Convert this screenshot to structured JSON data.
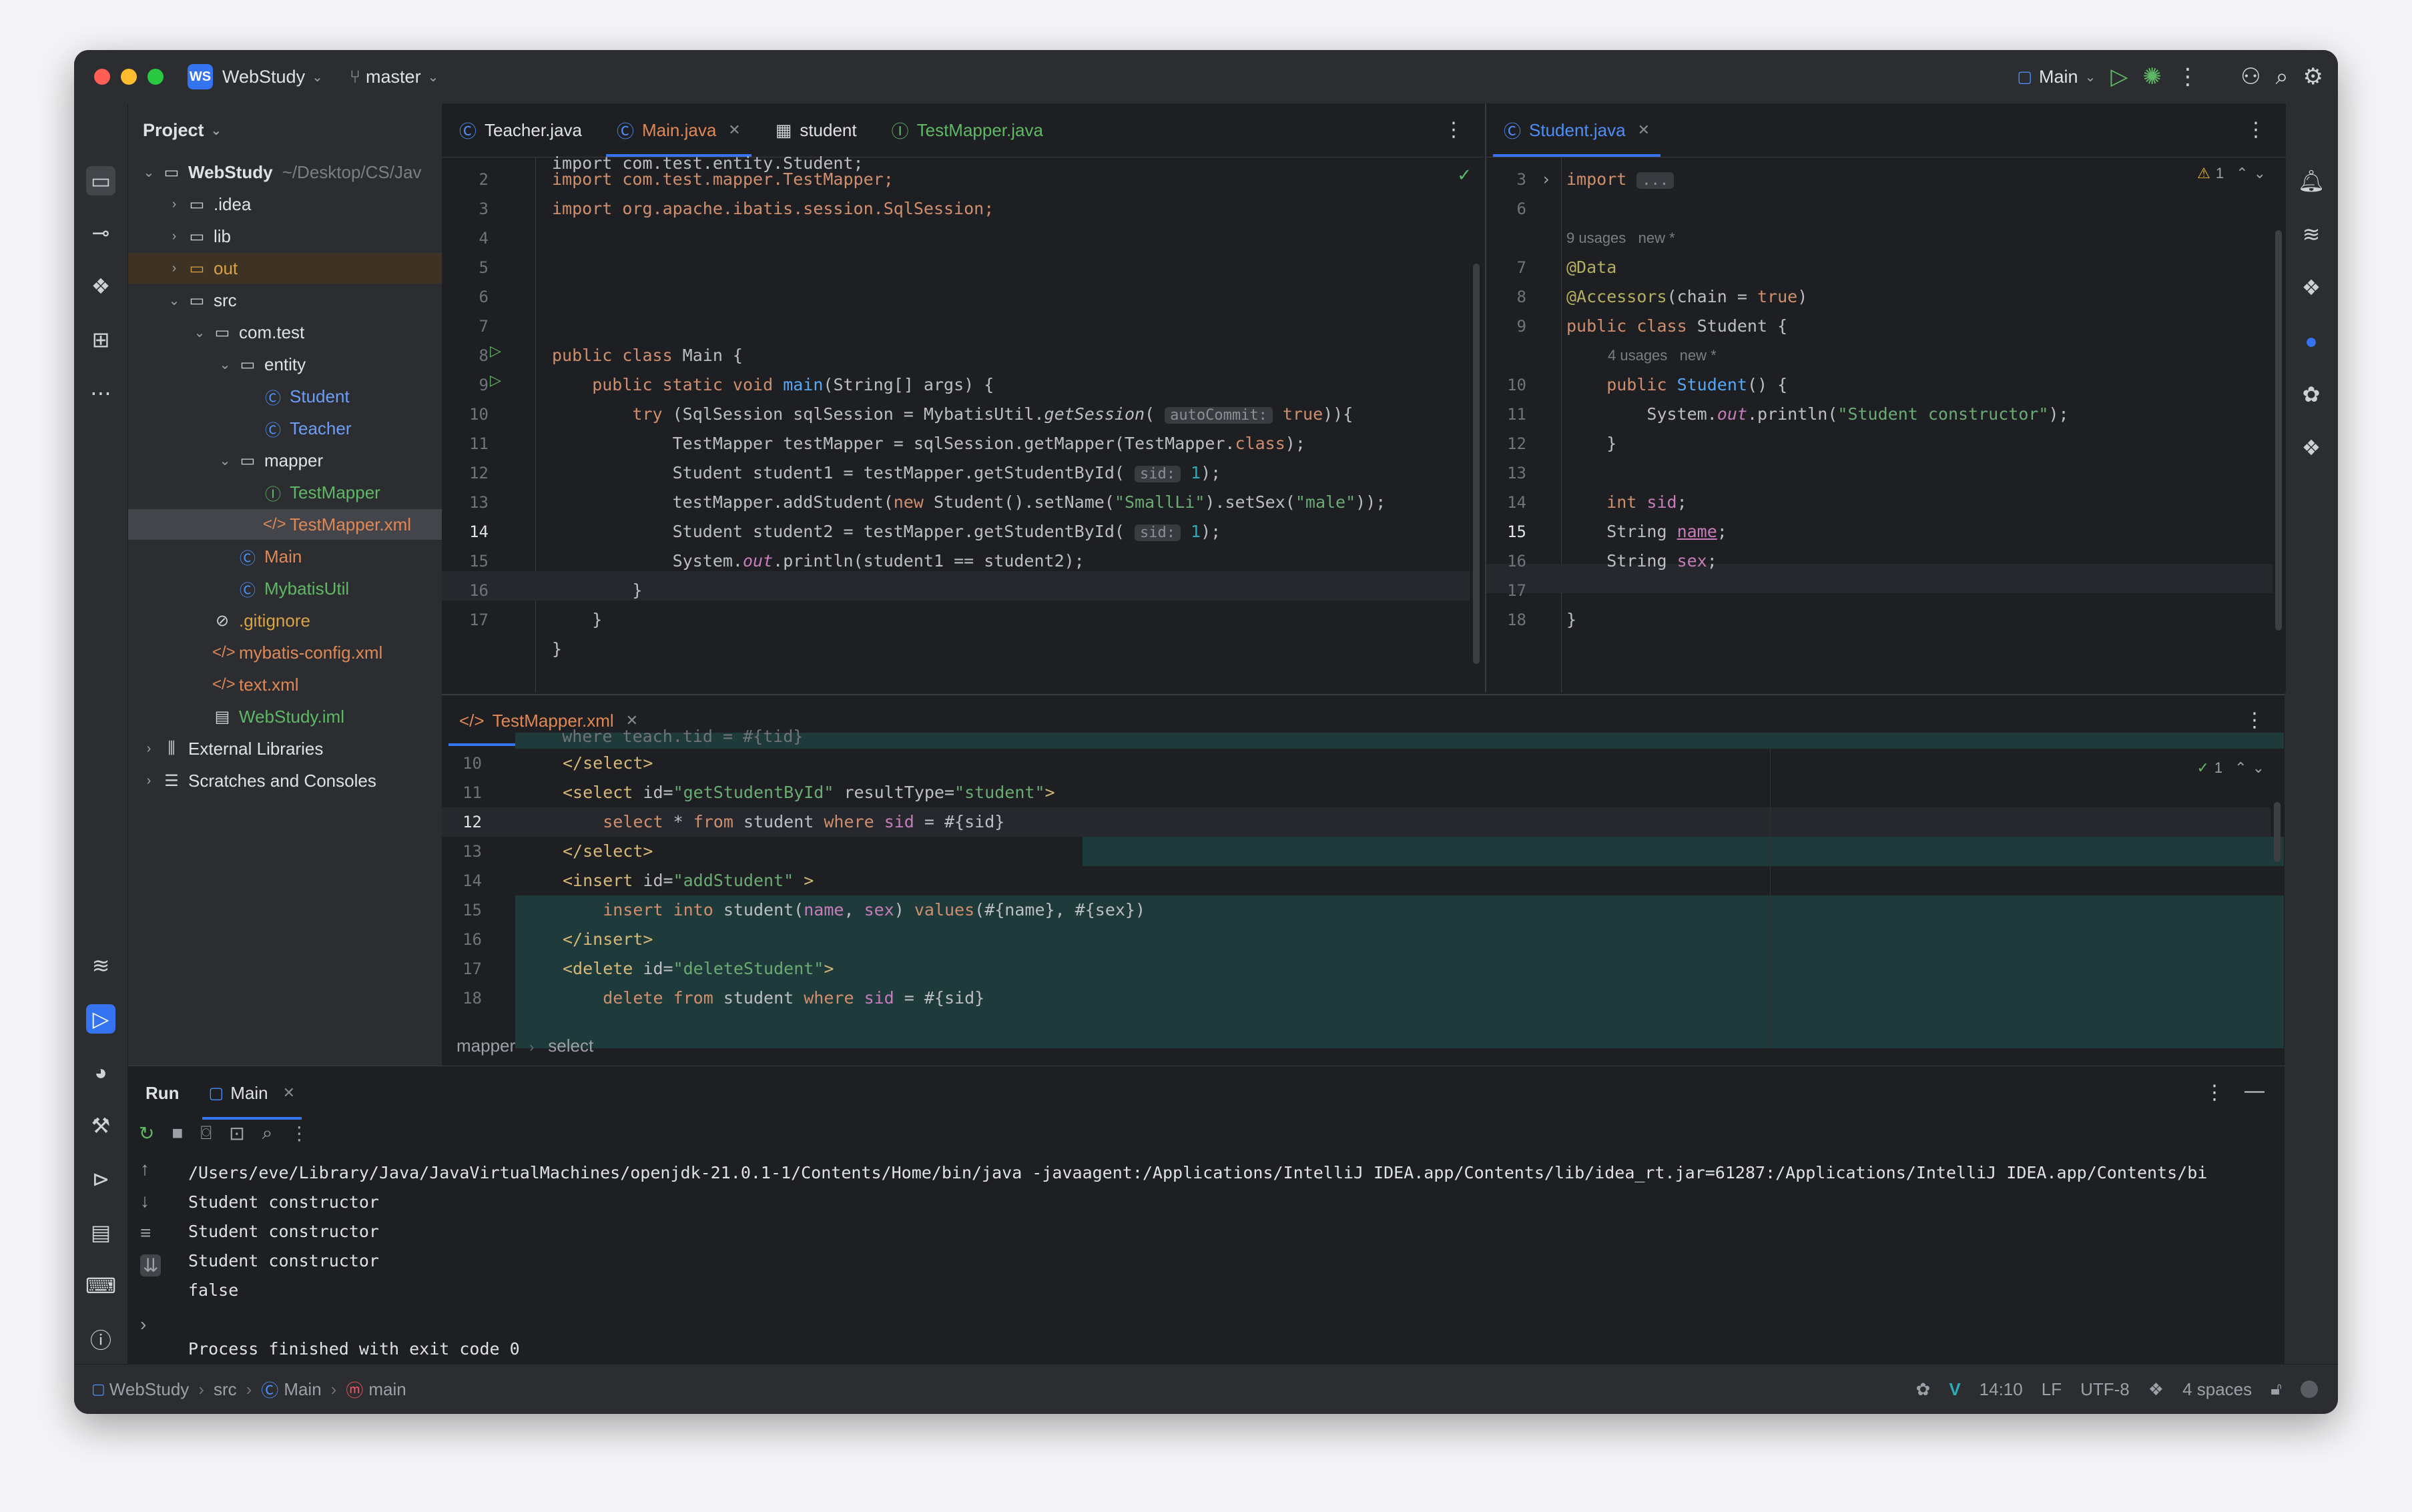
{
  "titlebar": {
    "project_badge": "WS",
    "project_name": "WebStudy",
    "branch": "master",
    "run_config": "Main"
  },
  "project_panel": {
    "title": "Project",
    "tree": [
      {
        "label": "WebStudy",
        "suffix": "~/Desktop/CS/Jav",
        "level": 0,
        "icon": "folder",
        "expanded": true
      },
      {
        "label": ".idea",
        "level": 1,
        "icon": "folder",
        "expanded": false
      },
      {
        "label": "lib",
        "level": 1,
        "icon": "folder",
        "expanded": false
      },
      {
        "label": "out",
        "level": 1,
        "icon": "folder",
        "expanded": false,
        "state": "excluded"
      },
      {
        "label": "src",
        "level": 1,
        "icon": "folder",
        "expanded": true
      },
      {
        "label": "com.test",
        "level": 2,
        "icon": "package",
        "expanded": true
      },
      {
        "label": "entity",
        "level": 3,
        "icon": "package",
        "expanded": true
      },
      {
        "label": "Student",
        "level": 4,
        "icon": "class"
      },
      {
        "label": "Teacher",
        "level": 4,
        "icon": "class"
      },
      {
        "label": "mapper",
        "level": 3,
        "icon": "package",
        "expanded": true
      },
      {
        "label": "TestMapper",
        "level": 4,
        "icon": "interface"
      },
      {
        "label": "TestMapper.xml",
        "level": 4,
        "icon": "xml",
        "selected": true
      },
      {
        "label": "Main",
        "level": 3,
        "icon": "class"
      },
      {
        "label": "MybatisUtil",
        "level": 3,
        "icon": "class"
      },
      {
        "label": ".gitignore",
        "level": 2,
        "icon": "ignore"
      },
      {
        "label": "mybatis-config.xml",
        "level": 2,
        "icon": "xml"
      },
      {
        "label": "text.xml",
        "level": 2,
        "icon": "xml"
      },
      {
        "label": "WebStudy.iml",
        "level": 2,
        "icon": "iml"
      },
      {
        "label": "External Libraries",
        "level": 0,
        "icon": "library",
        "expanded": false
      },
      {
        "label": "Scratches and Consoles",
        "level": 0,
        "icon": "scratches",
        "expanded": false
      }
    ]
  },
  "left_editor": {
    "tabs": [
      {
        "label": "Teacher.java",
        "icon": "class"
      },
      {
        "label": "Main.java",
        "icon": "class",
        "active": true,
        "closable": true
      },
      {
        "label": "student",
        "icon": "table"
      },
      {
        "label": "TestMapper.java",
        "icon": "interface"
      }
    ],
    "line_numbers": [
      "2",
      "3",
      "4",
      "5",
      "6",
      "7",
      "8",
      "9",
      "10",
      "11",
      "12",
      "13",
      "14",
      "15",
      "16",
      "17"
    ],
    "code_top": "import com.test.entity.Student;",
    "lines": {
      "l2": "import com.test.mapper.TestMapper;",
      "l3": "import org.apache.ibatis.session.SqlSession;",
      "l6_a": "public class ",
      "l6_b": "Main {",
      "l7_a": "    public static void ",
      "l7_b": "main",
      "l7_c": "(String[] args) {",
      "l8_a": "        try ",
      "l8_b": "(SqlSession sqlSession = MybatisUtil.",
      "l8_c": "getSession",
      "l8_d": "( ",
      "l8_hint": "autoCommit:",
      "l8_e": " true",
      "l8_f": ")){",
      "l9_a": "            TestMapper testMapper = sqlSession.getMapper(TestMapper.",
      "l9_b": "class",
      "l9_c": ");",
      "l10_a": "            Student student1 = testMapper.getStudentById( ",
      "l10_hint": "sid:",
      "l10_b": " 1",
      "l10_c": ");",
      "l11_a": "            testMapper.addStudent(",
      "l11_b": "new ",
      "l11_c": "Student().setName(",
      "l11_d": "\"SmallLi\"",
      "l11_e": ").setSex(",
      "l11_f": "\"male\"",
      "l11_g": "));",
      "l12_a": "            Student student2 = testMapper.getStudentById( ",
      "l12_hint": "sid:",
      "l12_b": " 1",
      "l12_c": ");",
      "l13_a": "            System.",
      "l13_b": "out",
      "l13_c": ".println(student1 == student2);",
      "l14": "        }",
      "l15": "    }",
      "l16": "}"
    }
  },
  "right_editor": {
    "tab": "Student.java",
    "warning_count": "1",
    "line_numbers": [
      "3",
      "6",
      "7",
      "8",
      "9",
      "10",
      "11",
      "12",
      "13",
      "14",
      "15",
      "16",
      "17",
      "18"
    ],
    "lines": {
      "import_kw": "import",
      "import_fold": "...",
      "usages_9": "9 usages",
      "new_1": "new *",
      "data": "@Data",
      "acc_a": "@Accessors",
      "acc_b": "(chain = ",
      "acc_c": "true",
      "acc_d": ")",
      "cls_a": "public class ",
      "cls_b": "Student {",
      "usages_4": "4 usages",
      "new_2": "new *",
      "ctor_a": "    public ",
      "ctor_b": "Student",
      "ctor_c": "() {",
      "print_a": "        System.",
      "print_b": "out",
      "print_c": ".println(",
      "print_d": "\"Student constructor\"",
      "print_e": ");",
      "close_ctor": "    }",
      "sid_a": "    int ",
      "sid_b": "sid",
      "sid_c": ";",
      "name_a": "    String ",
      "name_b": "name",
      "name_c": ";",
      "sex_a": "    String ",
      "sex_b": "sex",
      "sex_c": ";",
      "close": "}"
    }
  },
  "xml_editor": {
    "tab": "TestMapper.xml",
    "check_count": "1",
    "line_numbers": [
      "10",
      "11",
      "12",
      "13",
      "14",
      "15",
      "16",
      "17",
      "18"
    ],
    "lines": {
      "top": "    where teach.tid = #{tid}",
      "l10": "</select>",
      "l11_a": "<select ",
      "l11_b": "id=",
      "l11_c": "\"getStudentById\"",
      "l11_d": " resultType=",
      "l11_e": "\"student\"",
      "l11_f": ">",
      "l12_a": "    select ",
      "l12_b": "* ",
      "l12_c": "from ",
      "l12_d": "student ",
      "l12_e": "where ",
      "l12_f": "sid",
      "l12_g": " = #{sid}",
      "l13": "</select>",
      "l14_a": "<insert ",
      "l14_b": "id=",
      "l14_c": "\"addStudent\"",
      "l14_d": " >",
      "l15_a": "    insert into ",
      "l15_b": "student(",
      "l15_c": "name",
      "l15_d": ", ",
      "l15_e": "sex",
      "l15_f": ") ",
      "l15_g": "values",
      "l15_h": "(#{name}, #{sex})",
      "l16": "</insert>",
      "l17_a": "<delete ",
      "l17_b": "id=",
      "l17_c": "\"deleteStudent\"",
      "l17_d": ">",
      "l18_a": "    delete from ",
      "l18_b": "student ",
      "l18_c": "where ",
      "l18_d": "sid",
      "l18_e": " = #{sid}"
    },
    "breadcrumb": [
      "mapper",
      "select"
    ]
  },
  "run_panel": {
    "title": "Run",
    "tab": "Main",
    "console": [
      "/Users/eve/Library/Java/JavaVirtualMachines/openjdk-21.0.1-1/Contents/Home/bin/java -javaagent:/Applications/IntelliJ IDEA.app/Contents/lib/idea_rt.jar=61287:/Applications/IntelliJ IDEA.app/Contents/bi",
      "Student constructor",
      "Student constructor",
      "Student constructor",
      "false",
      "",
      "Process finished with exit code 0"
    ]
  },
  "statusbar": {
    "crumbs": [
      "WebStudy",
      "src",
      "Main",
      "main"
    ],
    "position": "14:10",
    "line_sep": "LF",
    "encoding": "UTF-8",
    "indent": "4 spaces"
  },
  "colors": {
    "accent": "#3574f0",
    "bg": "#1e1f22",
    "panel": "#2b2d30"
  }
}
